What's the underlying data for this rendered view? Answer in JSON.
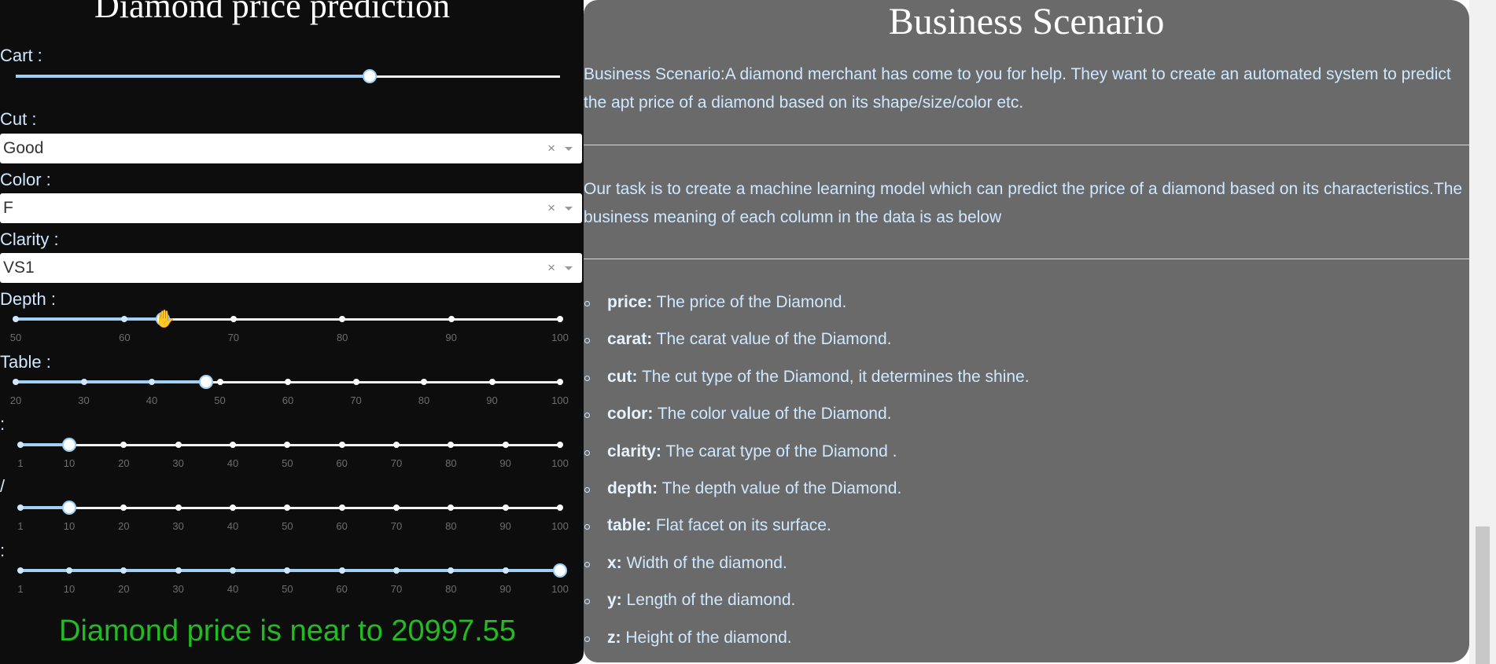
{
  "left": {
    "title": "Diamond price prediction",
    "cart": {
      "label": "Cart :",
      "value": 0.65
    },
    "cut": {
      "label": "Cut :",
      "selected": "Good"
    },
    "color": {
      "label": "Color :",
      "selected": "F"
    },
    "clarity": {
      "label": "Clarity :",
      "selected": "VS1"
    },
    "clear_glyph": "×",
    "depth": {
      "label": "Depth :",
      "value": 63.5,
      "marks": [
        "50",
        "60",
        "70",
        "80",
        "90",
        "100"
      ]
    },
    "table": {
      "label": "Table :",
      "value": 48,
      "marks": [
        "20",
        "30",
        "40",
        "50",
        "60",
        "70",
        "80",
        "90",
        "100"
      ]
    },
    "x": {
      "label": ":",
      "value": 10,
      "marks": [
        "1",
        "10",
        "20",
        "30",
        "40",
        "50",
        "60",
        "70",
        "80",
        "90",
        "100"
      ]
    },
    "y": {
      "label": "/",
      "value": 10,
      "marks": [
        "1",
        "10",
        "20",
        "30",
        "40",
        "50",
        "60",
        "70",
        "80",
        "90",
        "100"
      ]
    },
    "z": {
      "label": ":",
      "value": 100,
      "marks": [
        "1",
        "10",
        "20",
        "30",
        "40",
        "50",
        "60",
        "70",
        "80",
        "90",
        "100"
      ]
    },
    "result": "Diamond price is near to 20997.55"
  },
  "right": {
    "title": "Business Scenario",
    "para1": "Business Scenario:A diamond merchant has come to you for help. They want to create an automated system to predict the apt price of a diamond based on its shape/size/color etc.",
    "para2": "Our task is to create a machine learning model which can predict the price of a diamond based on its characteristics.The business meaning of each column in the data is as below",
    "features": [
      {
        "key": "price:",
        "desc": "The price of the Diamond."
      },
      {
        "key": "carat:",
        "desc": "The carat value of the Diamond."
      },
      {
        "key": "cut:",
        "desc": "The cut type of the Diamond, it determines the shine."
      },
      {
        "key": "color:",
        "desc": "The color value of the Diamond."
      },
      {
        "key": "clarity:",
        "desc": "The carat type of the Diamond ."
      },
      {
        "key": "depth:",
        "desc": "The depth value of the Diamond."
      },
      {
        "key": "table:",
        "desc": "Flat facet on its surface."
      },
      {
        "key": "x:",
        "desc": "Width of the diamond."
      },
      {
        "key": "y:",
        "desc": "Length of the diamond."
      },
      {
        "key": "z:",
        "desc": "Height of the diamond."
      }
    ]
  },
  "colors": {
    "accent": "#9fd0f3",
    "result": "#22bb22",
    "text": "#cfe8ff"
  }
}
